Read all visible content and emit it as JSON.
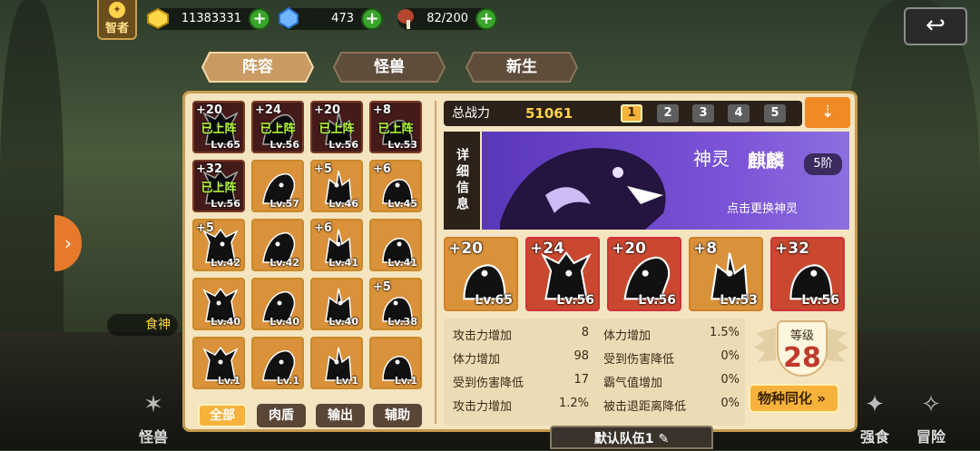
{
  "topbar": {
    "title_badge": "智者",
    "gold": "11383331",
    "diamond": "473",
    "meat": "82/200"
  },
  "tabs": [
    {
      "label": "阵容",
      "active": true
    },
    {
      "label": "怪兽",
      "active": false
    },
    {
      "label": "新生",
      "active": false
    }
  ],
  "roster": [
    {
      "plus": "+20",
      "lv": "Lv.65",
      "deployed": "已上阵",
      "style": "dark"
    },
    {
      "plus": "+24",
      "lv": "Lv.56",
      "deployed": "已上阵",
      "style": "dark"
    },
    {
      "plus": "+20",
      "lv": "Lv.56",
      "deployed": "已上阵",
      "style": "dark"
    },
    {
      "plus": "+8",
      "lv": "Lv.53",
      "deployed": "已上阵",
      "style": "dark"
    },
    {
      "plus": "+32",
      "lv": "Lv.56",
      "deployed": "已上阵",
      "style": "dark"
    },
    {
      "plus": "",
      "lv": "Lv.57",
      "deployed": "",
      "style": "orange"
    },
    {
      "plus": "+5",
      "lv": "Lv.46",
      "deployed": "",
      "style": "orange"
    },
    {
      "plus": "+6",
      "lv": "Lv.45",
      "deployed": "",
      "style": "orange"
    },
    {
      "plus": "+5",
      "lv": "Lv.42",
      "deployed": "",
      "style": "orange"
    },
    {
      "plus": "",
      "lv": "Lv.42",
      "deployed": "",
      "style": "orange"
    },
    {
      "plus": "+6",
      "lv": "Lv.41",
      "deployed": "",
      "style": "orange"
    },
    {
      "plus": "",
      "lv": "Lv.41",
      "deployed": "",
      "style": "orange"
    },
    {
      "plus": "",
      "lv": "Lv.40",
      "deployed": "",
      "style": "orange"
    },
    {
      "plus": "",
      "lv": "Lv.40",
      "deployed": "",
      "style": "orange"
    },
    {
      "plus": "",
      "lv": "Lv.40",
      "deployed": "",
      "style": "orange"
    },
    {
      "plus": "+5",
      "lv": "Lv.38",
      "deployed": "",
      "style": "orange"
    },
    {
      "plus": "",
      "lv": "Lv.1",
      "deployed": "",
      "style": "orange"
    },
    {
      "plus": "",
      "lv": "Lv.1",
      "deployed": "",
      "style": "orange"
    },
    {
      "plus": "",
      "lv": "Lv.1",
      "deployed": "",
      "style": "orange"
    },
    {
      "plus": "",
      "lv": "Lv.1",
      "deployed": "",
      "style": "orange"
    }
  ],
  "filters": [
    {
      "label": "全部",
      "active": true
    },
    {
      "label": "肉盾",
      "active": false
    },
    {
      "label": "输出",
      "active": false
    },
    {
      "label": "辅助",
      "active": false
    }
  ],
  "power": {
    "label": "总战力",
    "value": "51061"
  },
  "team_tabs": [
    {
      "label": "1",
      "active": true
    },
    {
      "label": "2",
      "active": false
    },
    {
      "label": "3",
      "active": false
    },
    {
      "label": "4",
      "active": false
    },
    {
      "label": "5",
      "active": false
    }
  ],
  "detail_label": "详细信息",
  "spirit": {
    "type": "神灵",
    "name": "麒麟",
    "rank": "5阶",
    "tip": "点击更换神灵"
  },
  "team": [
    {
      "plus": "+20",
      "lv": "Lv.65",
      "style": "orange"
    },
    {
      "plus": "+24",
      "lv": "Lv.56",
      "style": "red"
    },
    {
      "plus": "+20",
      "lv": "Lv.56",
      "style": "red"
    },
    {
      "plus": "+8",
      "lv": "Lv.53",
      "style": "orange"
    },
    {
      "plus": "+32",
      "lv": "Lv.56",
      "style": "red"
    }
  ],
  "stats": [
    {
      "label": "攻击力增加",
      "value": "8"
    },
    {
      "label": "体力增加",
      "value": "1.5%"
    },
    {
      "label": "体力增加",
      "value": "98"
    },
    {
      "label": "受到伤害降低",
      "value": "0%"
    },
    {
      "label": "受到伤害降低",
      "value": "17"
    },
    {
      "label": "霸气值增加",
      "value": "0%"
    },
    {
      "label": "攻击力增加",
      "value": "1.2%"
    },
    {
      "label": "被击退距离降低",
      "value": "0%"
    }
  ],
  "grade": {
    "label": "等级",
    "value": "28"
  },
  "sync_button": "物种同化",
  "team_name": "默认队伍1",
  "side": {
    "food_god": "食神"
  },
  "bottom_nav": [
    {
      "label": "怪兽"
    },
    {
      "label": "强食"
    },
    {
      "label": "冒险"
    }
  ],
  "colors": {
    "accent": "#f6b23a",
    "panel": "#f4e4c0",
    "deployed": "#b7ff3c",
    "grade": "#c0392b"
  }
}
